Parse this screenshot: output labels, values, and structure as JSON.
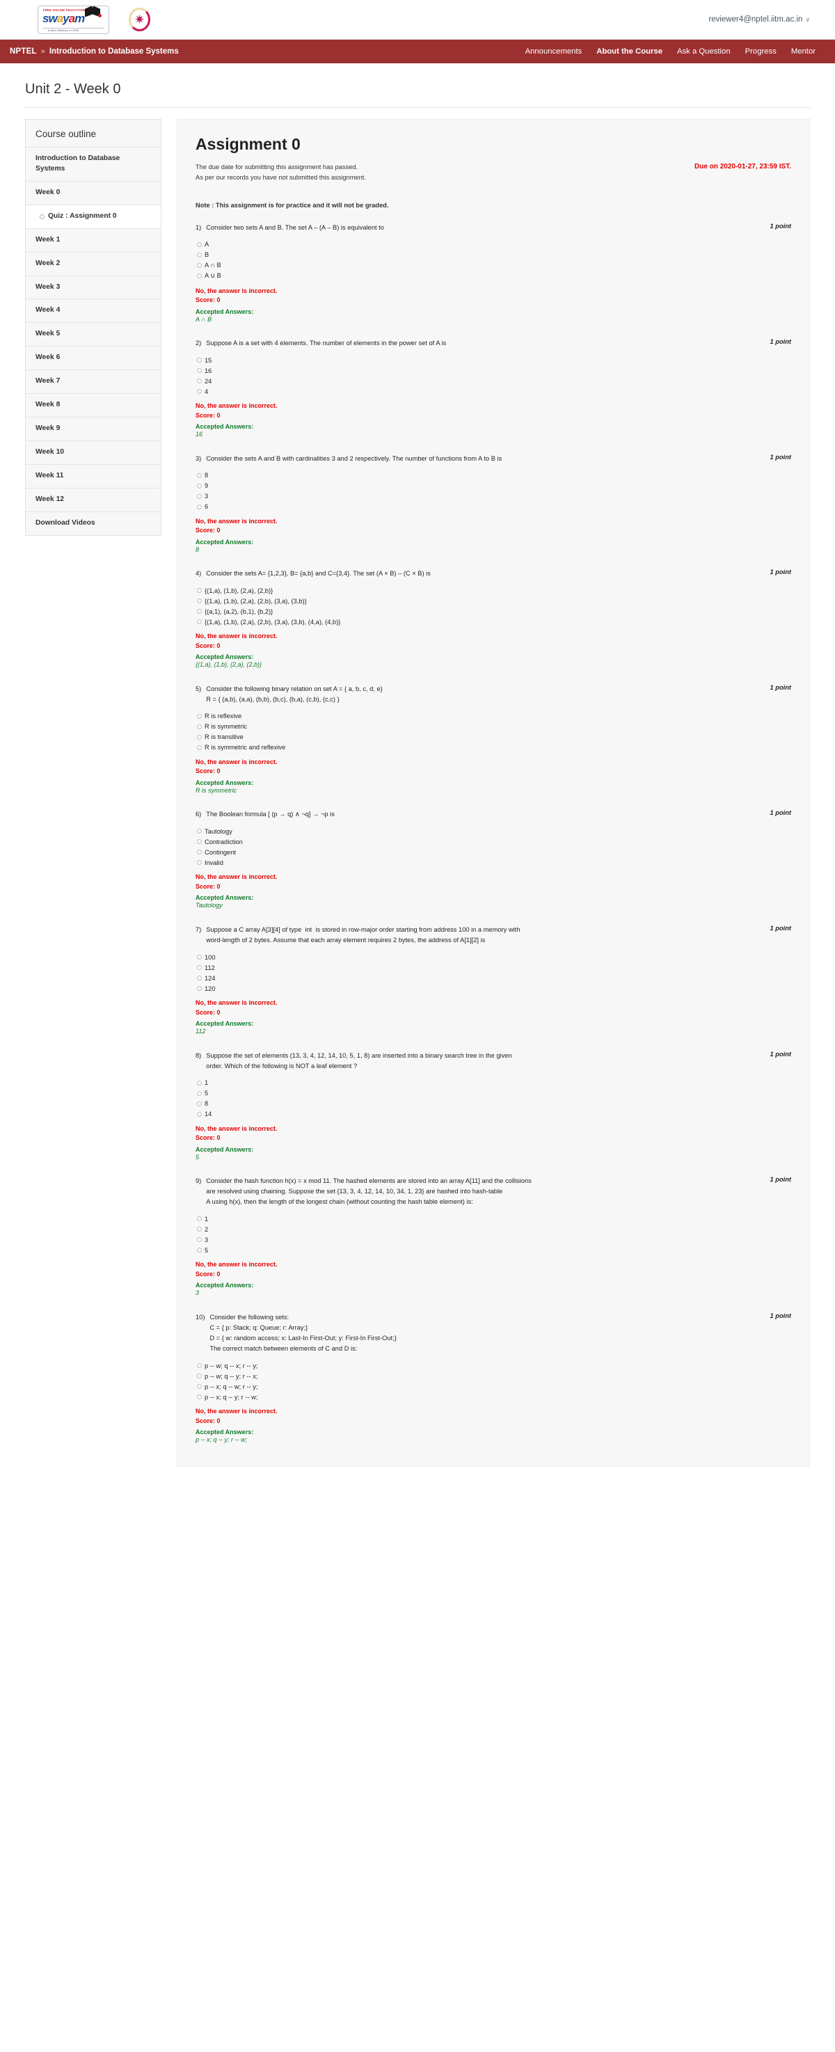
{
  "header": {
    "swayam_logo": {
      "tagline": "FREE ONLINE EDUCATION",
      "word": "swayam",
      "subtitle": "Indian Ministry of HRD"
    },
    "user_email": "reviewer4@nptel.iitm.ac.in",
    "caret": "∨"
  },
  "nav": {
    "brand": "NPTEL",
    "separator": "»",
    "course": "Introduction to Database Systems",
    "links": [
      {
        "label": "Announcements",
        "active": false
      },
      {
        "label": "About the Course",
        "active": true
      },
      {
        "label": "Ask a Question",
        "active": false
      },
      {
        "label": "Progress",
        "active": false
      },
      {
        "label": "Mentor",
        "active": false
      }
    ]
  },
  "page_title": "Unit 2 - Week 0",
  "sidebar": {
    "heading": "Course outline",
    "items": [
      {
        "label": "Introduction to Database Systems",
        "type": "section"
      },
      {
        "label": "Week 0",
        "type": "section"
      },
      {
        "label": "Quiz : Assignment 0",
        "type": "quiz"
      },
      {
        "label": "Week 1",
        "type": "section"
      },
      {
        "label": "Week 2",
        "type": "section"
      },
      {
        "label": "Week 3",
        "type": "section"
      },
      {
        "label": "Week 4",
        "type": "section"
      },
      {
        "label": "Week 5",
        "type": "section"
      },
      {
        "label": "Week 6",
        "type": "section"
      },
      {
        "label": "Week 7",
        "type": "section"
      },
      {
        "label": "Week 8",
        "type": "section"
      },
      {
        "label": "Week 9",
        "type": "section"
      },
      {
        "label": "Week 10",
        "type": "section"
      },
      {
        "label": "Week 11",
        "type": "section"
      },
      {
        "label": "Week 12",
        "type": "section"
      },
      {
        "label": "Download Videos",
        "type": "section"
      }
    ]
  },
  "assignment": {
    "title": "Assignment 0",
    "status_line_1": "The due date for submitting this assignment has passed.",
    "status_line_2": "As per our records you have not submitted this assignment.",
    "due_text": "Due on 2020-01-27, 23:59 IST.",
    "note": "Note : This assignment is for practice and it will not be graded.",
    "points_label": "1 point",
    "feedback_incorrect": "No, the answer is incorrect.",
    "score_label": "Score: 0",
    "accepted_label": "Accepted Answers:",
    "questions": [
      {
        "num": "1)",
        "lines": [
          "Consider two sets A and B. The set A – (A – B) is equivalent to"
        ],
        "points": "1 point",
        "options": [
          "A",
          "B",
          "A ∩ B",
          "A ∪ B"
        ],
        "accepted": "A ∩ B"
      },
      {
        "num": "2)",
        "lines": [
          "Suppose A is a set with 4 elements. The number of elements in the power set of A is"
        ],
        "points": "1 point",
        "options": [
          "15",
          "16",
          "24",
          "4"
        ],
        "accepted": "16"
      },
      {
        "num": "3)",
        "lines": [
          "Consider the sets A and B with cardinalities 3 and 2 respectively. The number of functions from A to B is"
        ],
        "points": "1 point",
        "options": [
          "8",
          "9",
          "3",
          "6"
        ],
        "accepted": "8"
      },
      {
        "num": "4)",
        "lines": [
          "Consider the sets A= {1,2,3}, B= {a,b} and C={3,4}. The set (A × B) – (C × B) is"
        ],
        "points": "1 point",
        "options": [
          "{(1,a), (1,b), (2,a), (2,b)}",
          "{(1,a), (1,b), (2,a), (2,b), (3,a), (3,b)}",
          "{(a,1), (a,2), (b,1), (b,2)}",
          "{(1,a), (1,b), (2,a), (2,b), (3,a), (3,b), (4,a), (4,b)}"
        ],
        "accepted": "{(1,a), (1,b), (2,a), (2,b)}"
      },
      {
        "num": "5)",
        "lines": [
          "Consider the following binary relation on set A = { a, b, c, d, e}",
          "R = { (a,b), (a,a), (b,b), (b,c), (b,a), (c,b), (c,c) }"
        ],
        "points": "1 point",
        "options": [
          "R is reflexive",
          "R is symmetric",
          "R is transitive",
          "R is symmetric and reflexive"
        ],
        "accepted": "R is symmetric"
      },
      {
        "num": "6)",
        "lines": [
          "The Boolean formula [ (p → q) ∧ ¬q] → ¬p is"
        ],
        "points": "1 point",
        "options": [
          "Tautology",
          "Contradiction",
          "Contingent",
          "Invalid"
        ],
        "accepted": "Tautology"
      },
      {
        "num": "7)",
        "lines": [
          "Suppose a C array A[3][4] of type  int  is stored in row-major order starting from address 100 in a memory with",
          "word-length of 2 bytes. Assume that each array element requires 2 bytes, the address of A[1][2] is"
        ],
        "points": "1 point",
        "options": [
          "100",
          "112",
          "124",
          "120"
        ],
        "accepted": "112"
      },
      {
        "num": "8)",
        "lines": [
          "Suppose the set of elements (13, 3, 4, 12, 14, 10, 5, 1, 8) are inserted into a binary search tree in the given",
          "order. Which of the following is NOT a leaf element ?"
        ],
        "points": "1 point",
        "options": [
          "1",
          "5",
          "8",
          "14"
        ],
        "accepted": "5"
      },
      {
        "num": "9)",
        "lines": [
          "Consider the hash function h(x) = x mod 11. The hashed elements are stored into an array A[11] and the collisions",
          "are resolved using chaining. Suppose the set {13, 3, 4, 12, 14, 10, 34, 1, 23} are hashed into hash-table",
          "A using h(x), then the length of the longest chain (without counting the hash table element) is:"
        ],
        "points": "1 point",
        "options": [
          "1",
          "2",
          "3",
          "5"
        ],
        "accepted": "3"
      },
      {
        "num": "10)",
        "lines": [
          "Consider the following sets:",
          "C = { p: Stack; q: Queue; r: Array;}",
          "D = { w: random access; x: Last-In First-Out; y: First-In First-Out;}",
          "The correct match between elements of C and D is:"
        ],
        "points": "1 point",
        "options": [
          "p -- w; q -- x; r -- y;",
          "p -- w; q -- y; r -- x;",
          "p -- x; q -- w; r -- y;",
          "p -- x; q -- y; r -- w;"
        ],
        "accepted": "p -- x; q -- y; r -- w;"
      }
    ]
  },
  "colors": {
    "nav_bg": "#9c3030",
    "due_red": "#e00000",
    "accepted_green": "#107a29",
    "panel_bg": "#f7f7f7"
  }
}
